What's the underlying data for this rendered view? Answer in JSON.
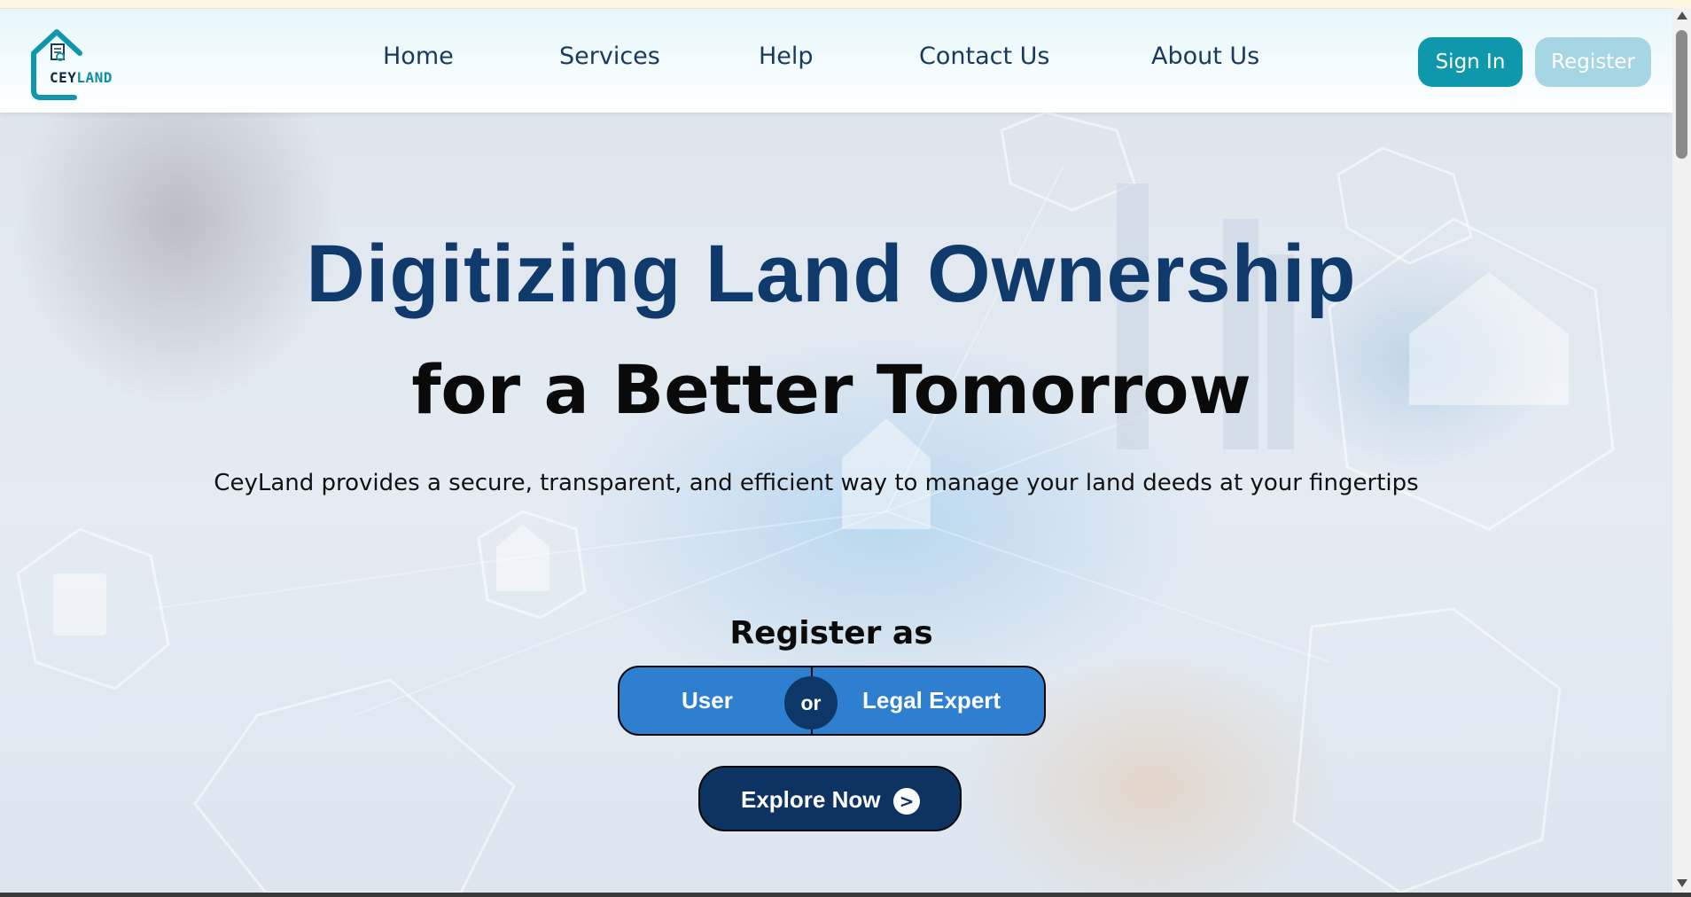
{
  "brand": {
    "logo_text_a": "CEY",
    "logo_text_b": "LAND"
  },
  "nav": {
    "items": [
      {
        "label": "Home"
      },
      {
        "label": "Services"
      },
      {
        "label": "Help"
      },
      {
        "label": "Contact Us"
      },
      {
        "label": "About Us"
      }
    ],
    "sign_in": "Sign In",
    "register": "Register"
  },
  "hero": {
    "headline": "Digitizing Land Ownership",
    "subheadline": "for a Better Tomorrow",
    "tagline": "CeyLand provides a secure, transparent, and efficient way to manage your land deeds at your fingertips",
    "register_as": "Register as",
    "option_user": "User",
    "option_or": "or",
    "option_legal": "Legal Expert",
    "explore": "Explore Now",
    "explore_arrow": ">"
  },
  "colors": {
    "accent": "#0f98ac",
    "headline": "#0f3a6b",
    "toggle": "#2f7fd1",
    "explore": "#0c3361",
    "register_button": "#a6d6e4"
  },
  "icons": [
    "home-check-icon",
    "arrow-right-icon",
    "scroll-up-icon",
    "scroll-down-icon"
  ]
}
